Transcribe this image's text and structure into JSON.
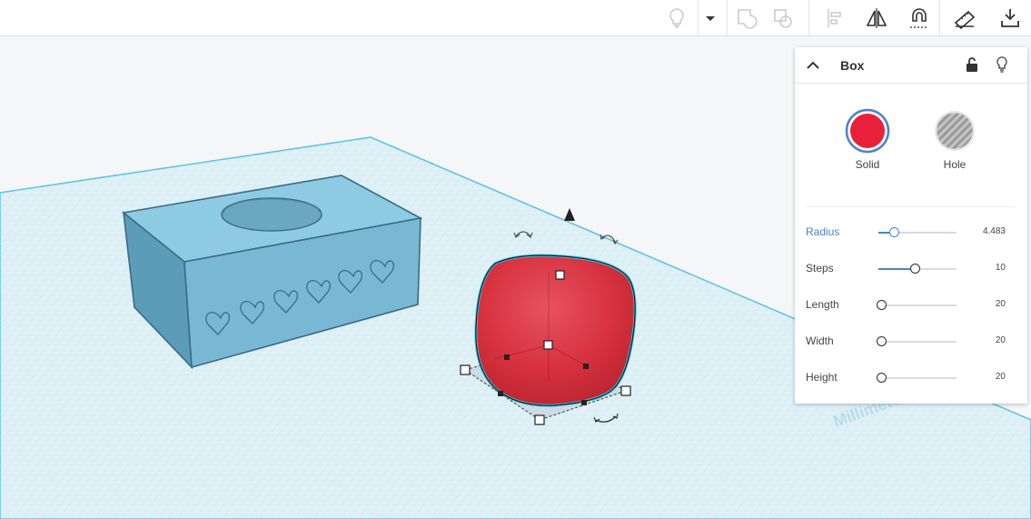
{
  "toolbar": {
    "icons": [
      "lightbulb-icon",
      "chevron-down-icon",
      "group-icon",
      "ungroup-icon",
      "align-icon",
      "mirror-icon",
      "magnet-icon",
      "ruler-icon",
      "import-icon"
    ]
  },
  "workplane": {
    "watermark": "Millimeters"
  },
  "inspector": {
    "title": "Box",
    "solid_label": "Solid",
    "hole_label": "Hole",
    "solid_color": "#e8203a",
    "properties": [
      {
        "label": "Radius",
        "value": "4.483",
        "fraction": 0.2
      },
      {
        "label": "Steps",
        "value": "10",
        "fraction": 0.47
      },
      {
        "label": "Length",
        "value": "20",
        "fraction": 0.0
      },
      {
        "label": "Width",
        "value": "20",
        "fraction": 0.0
      },
      {
        "label": "Height",
        "value": "20",
        "fraction": 0.0
      }
    ]
  },
  "colors": {
    "accent": "#4b83c8",
    "box_blue": "#7ec0db",
    "selection_cyan": "#3cc6e8"
  }
}
